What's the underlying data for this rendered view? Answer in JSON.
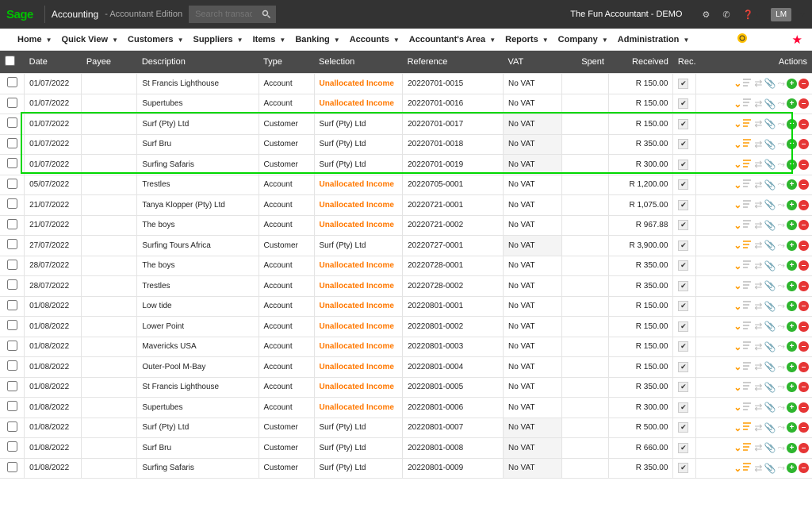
{
  "header": {
    "logo": "Sage",
    "app_title": "Accounting",
    "app_sub": "- Accountant Edition",
    "search_placeholder": "Search transactions",
    "company": "The Fun Accountant - DEMO",
    "user": "LM"
  },
  "menu": [
    "Home",
    "Quick View",
    "Customers",
    "Suppliers",
    "Items",
    "Banking",
    "Accounts",
    "Accountant's Area",
    "Reports",
    "Company",
    "Administration"
  ],
  "columns": {
    "date": "Date",
    "payee": "Payee",
    "desc": "Description",
    "type": "Type",
    "sel": "Selection",
    "ref": "Reference",
    "vat": "VAT",
    "spent": "Spent",
    "recv": "Received",
    "rec": "Rec.",
    "actions": "Actions"
  },
  "rows": [
    {
      "date": "01/07/2022",
      "payee": "",
      "desc": "St Francis Lighthouse",
      "type": "Account",
      "sel": "Unallocated Income",
      "sel_orange": true,
      "ref": "20220701-0015",
      "vat": "No VAT",
      "spent": "",
      "recv": "R 150.00",
      "hl": false,
      "split": false
    },
    {
      "date": "01/07/2022",
      "payee": "",
      "desc": "Supertubes",
      "type": "Account",
      "sel": "Unallocated Income",
      "sel_orange": true,
      "ref": "20220701-0016",
      "vat": "No VAT",
      "spent": "",
      "recv": "R 150.00",
      "hl": false,
      "split": false
    },
    {
      "date": "01/07/2022",
      "payee": "",
      "desc": "Surf (Pty) Ltd",
      "type": "Customer",
      "sel": "Surf (Pty) Ltd",
      "sel_orange": false,
      "ref": "20220701-0017",
      "vat": "No VAT",
      "spent": "",
      "recv": "R 150.00",
      "hl": true,
      "split": true
    },
    {
      "date": "01/07/2022",
      "payee": "",
      "desc": "Surf Bru",
      "type": "Customer",
      "sel": "Surf (Pty) Ltd",
      "sel_orange": false,
      "ref": "20220701-0018",
      "vat": "No VAT",
      "spent": "",
      "recv": "R 350.00",
      "hl": true,
      "split": true
    },
    {
      "date": "01/07/2022",
      "payee": "",
      "desc": "Surfing Safaris",
      "type": "Customer",
      "sel": "Surf (Pty) Ltd",
      "sel_orange": false,
      "ref": "20220701-0019",
      "vat": "No VAT",
      "spent": "",
      "recv": "R 300.00",
      "hl": true,
      "split": true
    },
    {
      "date": "05/07/2022",
      "payee": "",
      "desc": "Trestles",
      "type": "Account",
      "sel": "Unallocated Income",
      "sel_orange": true,
      "ref": "20220705-0001",
      "vat": "No VAT",
      "spent": "",
      "recv": "R 1,200.00",
      "hl": false,
      "split": false
    },
    {
      "date": "21/07/2022",
      "payee": "",
      "desc": "Tanya Klopper (Pty) Ltd",
      "type": "Account",
      "sel": "Unallocated Income",
      "sel_orange": true,
      "ref": "20220721-0001",
      "vat": "No VAT",
      "spent": "",
      "recv": "R 1,075.00",
      "hl": false,
      "split": false
    },
    {
      "date": "21/07/2022",
      "payee": "",
      "desc": "The boys",
      "type": "Account",
      "sel": "Unallocated Income",
      "sel_orange": true,
      "ref": "20220721-0002",
      "vat": "No VAT",
      "spent": "",
      "recv": "R 967.88",
      "hl": false,
      "split": false
    },
    {
      "date": "27/07/2022",
      "payee": "",
      "desc": "Surfing Tours Africa",
      "type": "Customer",
      "sel": "Surf (Pty) Ltd",
      "sel_orange": false,
      "ref": "20220727-0001",
      "vat": "No VAT",
      "spent": "",
      "recv": "R 3,900.00",
      "hl": false,
      "split": true
    },
    {
      "date": "28/07/2022",
      "payee": "",
      "desc": "The boys",
      "type": "Account",
      "sel": "Unallocated Income",
      "sel_orange": true,
      "ref": "20220728-0001",
      "vat": "No VAT",
      "spent": "",
      "recv": "R 350.00",
      "hl": false,
      "split": false
    },
    {
      "date": "28/07/2022",
      "payee": "",
      "desc": "Trestles",
      "type": "Account",
      "sel": "Unallocated Income",
      "sel_orange": true,
      "ref": "20220728-0002",
      "vat": "No VAT",
      "spent": "",
      "recv": "R 350.00",
      "hl": false,
      "split": false
    },
    {
      "date": "01/08/2022",
      "payee": "",
      "desc": "Low tide",
      "type": "Account",
      "sel": "Unallocated Income",
      "sel_orange": true,
      "ref": "20220801-0001",
      "vat": "No VAT",
      "spent": "",
      "recv": "R 150.00",
      "hl": false,
      "split": false
    },
    {
      "date": "01/08/2022",
      "payee": "",
      "desc": "Lower Point",
      "type": "Account",
      "sel": "Unallocated Income",
      "sel_orange": true,
      "ref": "20220801-0002",
      "vat": "No VAT",
      "spent": "",
      "recv": "R 150.00",
      "hl": false,
      "split": false
    },
    {
      "date": "01/08/2022",
      "payee": "",
      "desc": "Mavericks USA",
      "type": "Account",
      "sel": "Unallocated Income",
      "sel_orange": true,
      "ref": "20220801-0003",
      "vat": "No VAT",
      "spent": "",
      "recv": "R 150.00",
      "hl": false,
      "split": false
    },
    {
      "date": "01/08/2022",
      "payee": "",
      "desc": "Outer-Pool M-Bay",
      "type": "Account",
      "sel": "Unallocated Income",
      "sel_orange": true,
      "ref": "20220801-0004",
      "vat": "No VAT",
      "spent": "",
      "recv": "R 150.00",
      "hl": false,
      "split": false
    },
    {
      "date": "01/08/2022",
      "payee": "",
      "desc": "St Francis Lighthouse",
      "type": "Account",
      "sel": "Unallocated Income",
      "sel_orange": true,
      "ref": "20220801-0005",
      "vat": "No VAT",
      "spent": "",
      "recv": "R 350.00",
      "hl": false,
      "split": false
    },
    {
      "date": "01/08/2022",
      "payee": "",
      "desc": "Supertubes",
      "type": "Account",
      "sel": "Unallocated Income",
      "sel_orange": true,
      "ref": "20220801-0006",
      "vat": "No VAT",
      "spent": "",
      "recv": "R 300.00",
      "hl": false,
      "split": false
    },
    {
      "date": "01/08/2022",
      "payee": "",
      "desc": "Surf (Pty) Ltd",
      "type": "Customer",
      "sel": "Surf (Pty) Ltd",
      "sel_orange": false,
      "ref": "20220801-0007",
      "vat": "No VAT",
      "spent": "",
      "recv": "R 500.00",
      "hl": false,
      "split": true
    },
    {
      "date": "01/08/2022",
      "payee": "",
      "desc": "Surf Bru",
      "type": "Customer",
      "sel": "Surf (Pty) Ltd",
      "sel_orange": false,
      "ref": "20220801-0008",
      "vat": "No VAT",
      "spent": "",
      "recv": "R 660.00",
      "hl": false,
      "split": true
    },
    {
      "date": "01/08/2022",
      "payee": "",
      "desc": "Surfing Safaris",
      "type": "Customer",
      "sel": "Surf (Pty) Ltd",
      "sel_orange": false,
      "ref": "20220801-0009",
      "vat": "No VAT",
      "spent": "",
      "recv": "R 350.00",
      "hl": false,
      "split": true
    }
  ]
}
